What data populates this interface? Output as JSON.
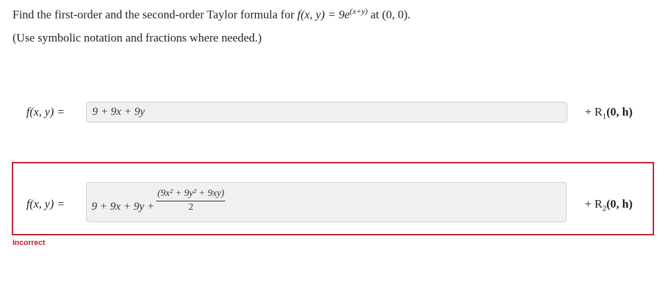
{
  "question": {
    "prefix": "Find the first-order and the second-order Taylor formula for ",
    "function": "f(x, y) = 9e",
    "exponent": "(x+y)",
    "suffix": " at (0, 0).",
    "instruction": "(Use symbolic notation and fractions where needed.)"
  },
  "first_order": {
    "lhs": "f(x, y) =",
    "answer": "9 + 9x + 9y",
    "remainder_prefix": "+ R",
    "remainder_sub": "1",
    "remainder_args": "(0, h)"
  },
  "second_order": {
    "lhs": "f(x, y) =",
    "answer_prefix": "9 + 9x + 9y +",
    "fraction_numerator": "(9x² + 9y² + 9xy)",
    "fraction_denominator": "2",
    "remainder_prefix": "+ R",
    "remainder_sub": "2",
    "remainder_args": "(0, h)"
  },
  "feedback": {
    "status": "Incorrect"
  },
  "colors": {
    "error": "#c0202a",
    "input_bg": "#f0f0f0",
    "input_border": "#cfcfcf"
  }
}
